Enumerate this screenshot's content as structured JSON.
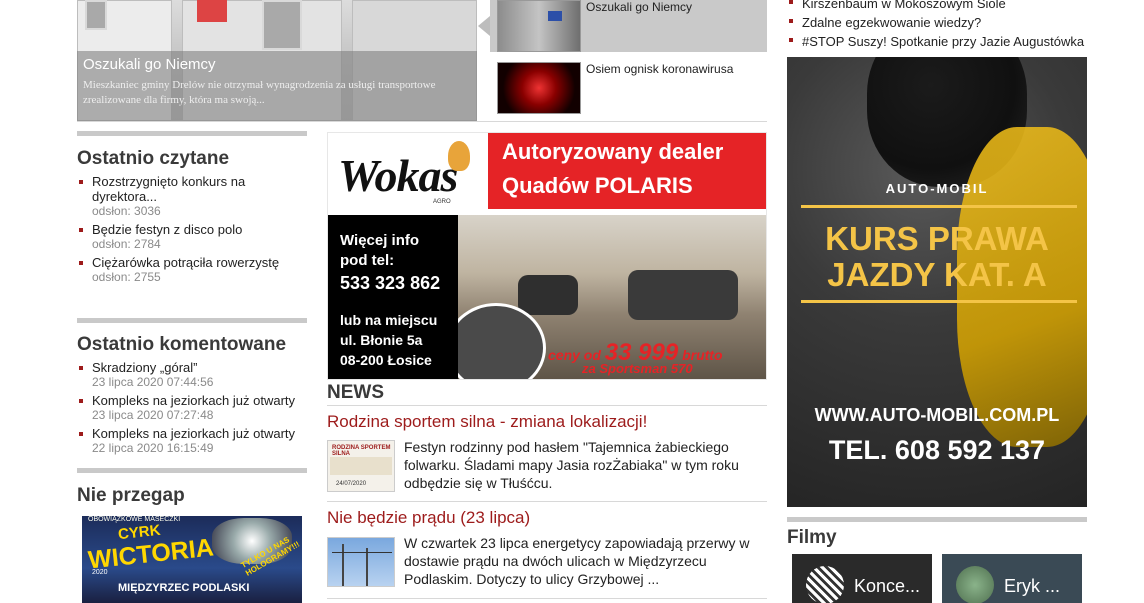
{
  "slider": {
    "main_title": "Oszukali go Niemcy",
    "main_desc": "Mieszkaniec gminy Drelów nie otrzymał wynagrodzenia za usługi transportowe zrealizowane dla firmy, która ma swoją...",
    "items": [
      {
        "title": "Oszukali go Niemcy"
      },
      {
        "title": "Osiem ognisk koronawirusa"
      }
    ]
  },
  "recently_read": {
    "heading": "Ostatnio czytane",
    "items": [
      {
        "title": "Rozstrzygnięto konkurs na dyrektora...",
        "meta": "odsłon: 3036"
      },
      {
        "title": "Będzie festyn z disco polo",
        "meta": "odsłon: 2784"
      },
      {
        "title": "Ciężarówka potrąciła rowerzystę",
        "meta": "odsłon: 2755"
      }
    ]
  },
  "recently_commented": {
    "heading": "Ostatnio komentowane",
    "items": [
      {
        "title": "Skradziony „góral”",
        "meta": "23 lipca 2020 07:44:56"
      },
      {
        "title": "Kompleks na jeziorkach już otwarty",
        "meta": "23 lipca 2020 07:27:48"
      },
      {
        "title": "Kompleks na jeziorkach już otwarty",
        "meta": "22 lipca 2020 16:15:49"
      }
    ]
  },
  "do_not_miss": {
    "heading": "Nie przegap",
    "poster": {
      "top": "OBOWIĄZKOWE MASECZKI",
      "line1": "CYRK",
      "line2": "WICTORIA",
      "badge": "TYLKO U NAS HOLOGRAMY!!!",
      "city": "MIĘDZYRZEC PODLASKI",
      "year": "2020"
    }
  },
  "ad_wokas": {
    "logo": "Wokas",
    "logo_sub": "AGRO",
    "headline1": "Autoryzowany dealer",
    "headline2": "Quadów POLARIS",
    "info1": "Więcej info",
    "info2": "pod tel:",
    "phone": "533 323 862",
    "loc1": "lub na miejscu",
    "loc2": "ul. Błonie 5a",
    "loc3": "08-200 Łosice",
    "price_prefix": "ceny od",
    "price": "33 999",
    "price_suffix": "brutto",
    "model": "za Sportsman 570"
  },
  "ad_automobil": {
    "brand": "AUTO-MOBIL",
    "line1": "KURS PRAWA",
    "line2": "JAZDY KAT. A",
    "www": "WWW.AUTO-MOBIL.COM.PL",
    "tel": "TEL. 608 592 137"
  },
  "news": {
    "heading": "NEWS",
    "items": [
      {
        "title": "Rodzina sportem silna - zmiana lokalizacji!",
        "text": "Festyn rodzinny pod hasłem \"Tajemnica żabieckiego folwarku. Śladami mapy Jasia rozŻabiaka\" w tym roku odbędzie się w Tłuśćcu.",
        "thumb_title": "RODZINA SPORTEM SILNA",
        "thumb_date": "24/07/2020"
      },
      {
        "title": "Nie będzie prądu (23 lipca)",
        "text": "W czwartek 23 lipca energetycy zapowiadają przerwy w dostawie prądu na dwóch ulicach w Międzyrzecu Podlaskim. Dotyczy to ulicy Grzybowej ..."
      }
    ]
  },
  "right_list": {
    "items": [
      "Kirszenbaum w Mokoszowym Siole",
      "Zdalne egzekwowanie wiedzy?",
      "#STOP Suszy! Spotkanie przy Jazie Augustówka"
    ]
  },
  "films": {
    "heading": "Filmy",
    "items": [
      {
        "label": "Konce..."
      },
      {
        "label": "Eryk ..."
      }
    ]
  },
  "colors": {
    "accent_red": "#9d1b1b",
    "separator_gray": "#c9c9c9",
    "wokas_red": "#e52326",
    "automobil_yellow": "#f4c447"
  }
}
